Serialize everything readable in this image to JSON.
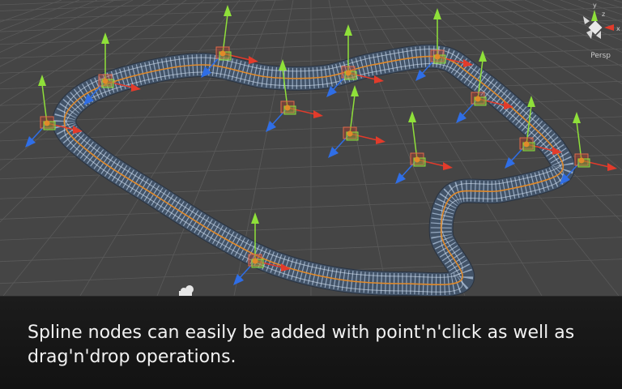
{
  "scene_view": {
    "projection_label": "Persp",
    "axes": {
      "x": "x",
      "y": "y",
      "z": "z"
    },
    "colors": {
      "background": "#454545",
      "grid": "#5a5a5a",
      "track_mesh": "#d7e4f4",
      "spline": "#e08a2a",
      "axis_y": "#8fe03a",
      "axis_x": "#e23b2b",
      "axis_z": "#2f6ee6"
    },
    "icons": [
      "scene-gizmo-icon",
      "spline-node-icon",
      "transform-handle-icon",
      "camera-icon"
    ]
  },
  "caption": {
    "text": "Spline nodes can easily be added with point'n'click as well as drag'n'drop operations."
  }
}
